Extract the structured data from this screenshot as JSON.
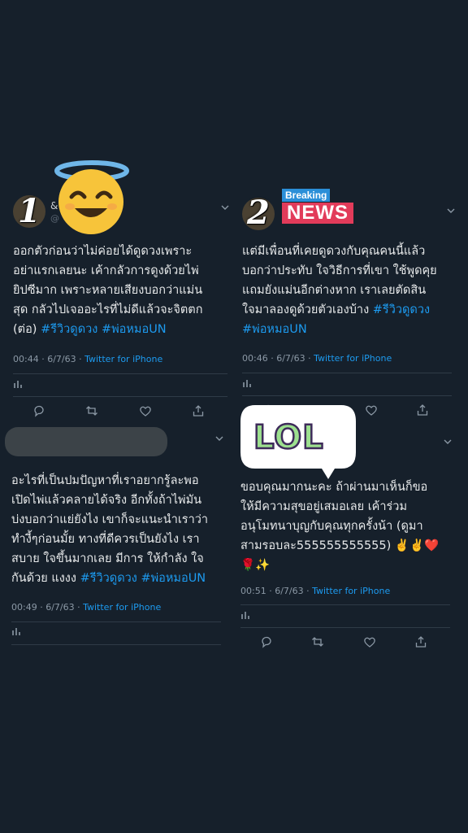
{
  "tweets": [
    {
      "numeral": "1",
      "handle": "@",
      "handle_prefix": "&",
      "text_lines": [
        "ออกตัวก่อนว่าไม่ค่อยได้ดูดวงเพราะ",
        "อย่าแรกเลยนะ เค้ากลัวการดูงด้วยไพ่",
        "ยิปซีมาก เพราะหลายเสียงบอกว่าแม่น",
        "สุด กลัวไปเจออะไรที่ไม่ดีแล้วจะจิตตก"
      ],
      "last_line_prefix": "(ต่อ) ",
      "hashtags": "#รีวิวดูดวง #พ่อหมอUN",
      "time": "00:44 · 6/7/63 · ",
      "source": "Twitter for iPhone"
    },
    {
      "numeral": "2",
      "sticker_breaking": "Breaking",
      "sticker_news": "NEWS",
      "text_lines": [
        "แต่มีเพื่อนที่เคยดูดวงกับคุณคนนี้แล้ว",
        "บอกว่าประทับ ใจวิธีการที่เขา ใช้พูดคุย",
        "แถมยังแม่นอีกต่างหาก เราเลยตัดสิน"
      ],
      "line4_prefix": "ใจมาลองดูด้วยตัวเองบ้าง ",
      "line4_tag": "#รีวิวดูดวง",
      "line5_tag": "#พ่อหมอUN",
      "time": "00:46 · 6/7/63 · ",
      "source": "Twitter for iPhone"
    },
    {
      "text_lines": [
        "อะไรที่เป็นปมปัญหาที่เราอยากรู้ละพอ",
        "เปิดไพ่แล้วคลายได้จริง อีกทั้งถ้าไพ่มัน",
        "บ่งบอกว่าแย่ยังไง เขาก็จะแนะนำเราว่า",
        "ทำงี้ๆก่อนมั้ย ทางที่ดีควรเป็นยังไง เรา",
        "สบาย ใจขึ้นมากเลย มีการ ให้กำลัง ใจ"
      ],
      "last_line_prefix": "กันด้วย แงงง ",
      "hashtags": "#รีวิวดูดวง #พ่อหมอUN",
      "time": "00:49 · 6/7/63 · ",
      "source": "Twitter for iPhone"
    },
    {
      "sticker_lol": "LOL",
      "text_lines": [
        "ขอบคุณมากนะคะ ถ้าผ่านมาเห็นก็ขอ",
        "ให้มีความสุขอยู่เสมอเลย เค้าร่วม",
        "อนุโมทนาบุญกับคุณทุกครั้งน้า (ดูมา",
        "สามรอบละ555555555555) ✌️✌️❤️",
        "🌹✨"
      ],
      "time": "00:51 · 6/7/63 · ",
      "source": "Twitter for iPhone"
    }
  ],
  "icons": [
    "smiling-face-with-halo-emoji",
    "chevron-down-icon",
    "stats-icon",
    "reply-icon",
    "retweet-icon",
    "like-icon",
    "share-icon"
  ],
  "colors": {
    "background": "#16202b",
    "link": "#1d9bf0",
    "meta": "#8b98a5",
    "divider": "#2f3b47"
  }
}
